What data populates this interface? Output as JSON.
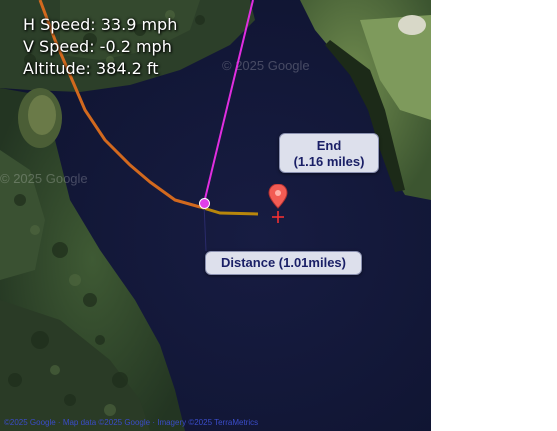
{
  "telemetry": {
    "h_speed": "H Speed: 33.9 mph",
    "v_speed": "V Speed: -0.2 mph",
    "altitude": "Altitude: 384.2 ft"
  },
  "watermarks": {
    "top": "© 2025 Google",
    "left": "© 2025 Google"
  },
  "end_label": {
    "title": "End",
    "distance": "(1.16 miles)"
  },
  "distance_label": "Distance (1.01miles)",
  "attribution": "©2025 Google · Map data ©2025 Google · Imagery ©2025 TerraMetrics",
  "colors": {
    "water": "#141a3a",
    "track_orange": "#d2691e",
    "track_gold": "#b8860b",
    "magenta_line": "#e02ee0",
    "marker": "#f25c54",
    "callout_bg": "#dde0ec",
    "callout_text": "#1a1f66"
  },
  "icons": {
    "end_marker": "map-pin-icon",
    "crosshair": "crosshair-icon",
    "current_point": "position-dot-icon"
  }
}
